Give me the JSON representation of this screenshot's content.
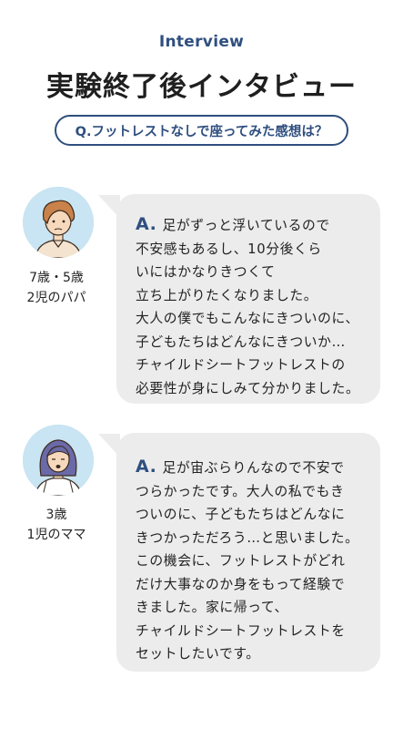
{
  "header": {
    "eyebrow": "Interview",
    "title": "実験終了後インタビュー",
    "question": "Q.フットレストなしで座ってみた感想は？"
  },
  "answers": [
    {
      "person_line1": "7歳・5歳",
      "person_line2": "2児のパパ",
      "avatar_icon": "father-avatar-icon",
      "a_mark": "A.",
      "lines": [
        "足がずっと浮いているので",
        "不安感もあるし、10分後くら",
        "いにはかなりきつくて",
        "立ち上がりたくなりました。",
        "大人の僕でもこんなにきついのに、",
        "子どもたちはどんなにきついか…",
        "チャイルドシートフットレストの",
        "必要性が身にしみて分かりました。"
      ]
    },
    {
      "person_line1": "3歳",
      "person_line2": "1児のママ",
      "avatar_icon": "mother-avatar-icon",
      "a_mark": "A.",
      "lines": [
        "足が宙ぶらりんなので不安で",
        "つらかったです。大人の私でもき",
        "ついのに、子どもたちはどんなに",
        "きつかっただろう…と思いました。",
        "この機会に、フットレストがどれ",
        "だけ大事なのか身をもって経験で",
        "きました。家に帰って、",
        "チャイルドシートフットレストを",
        "セットしたいです。"
      ]
    }
  ],
  "colors": {
    "accent": "#2f4f7f",
    "bubble": "#ececec",
    "avatar_bg": "#c9e4f2"
  }
}
